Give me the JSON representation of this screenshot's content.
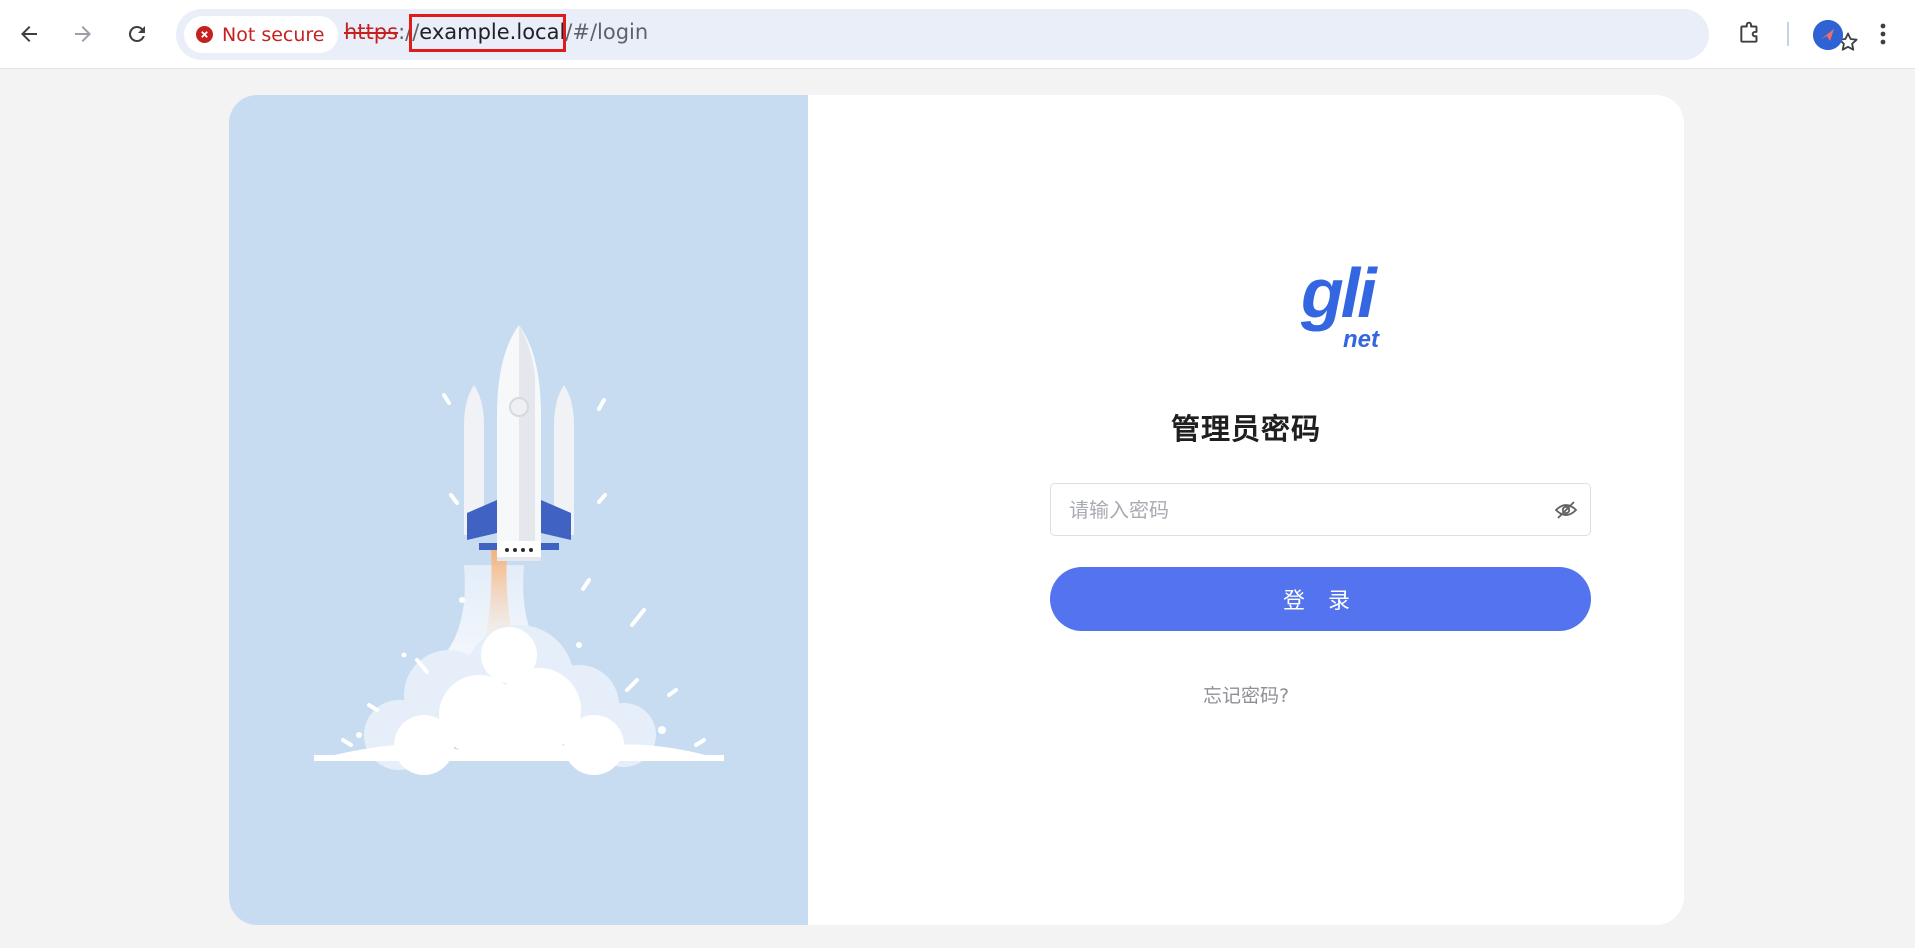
{
  "browser": {
    "security_label": "Not secure",
    "url": {
      "scheme": "https",
      "separator": "://",
      "host": "example.local",
      "path": "/#/login"
    },
    "icons": {
      "back": "back-arrow-icon",
      "forward": "forward-arrow-icon",
      "reload": "reload-icon",
      "security": "not-secure-icon",
      "bookmark": "star-icon",
      "extensions": "puzzle-icon",
      "profile": "avatar",
      "menu": "kebab-menu-icon"
    },
    "colors": {
      "not_secure": "#c5221f",
      "omnibox_bg": "#e9eef8",
      "highlight_box": "#e01b1b"
    }
  },
  "login": {
    "logo_text": "gli net",
    "title": "管理员密码",
    "password_placeholder": "请输入密码",
    "password_value": "",
    "login_label": "登 录",
    "forgot_label": "忘记密码?",
    "colors": {
      "primary": "#5473ee",
      "logo": "#3366e0",
      "illustration_bg": "#c7dbf1"
    },
    "icons": {
      "password_toggle": "eye-off-icon",
      "illustration": "rocket-launch-illustration"
    }
  }
}
